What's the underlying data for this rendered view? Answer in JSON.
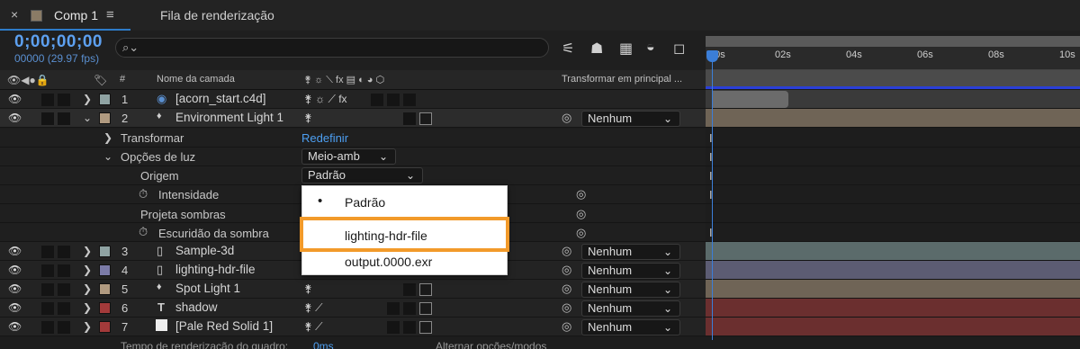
{
  "tabbar": {
    "close": "×",
    "comp_name": "Comp 1",
    "menu_icon": "≡",
    "render_tab": "Fila de renderização"
  },
  "header": {
    "timecode": "0;00;00;00",
    "fps": "00000 (29.97 fps)",
    "search_placeholder": "",
    "search_icon": "magnifier-icon",
    "icons": [
      "composition-flowchart-icon",
      "draft-3d-icon",
      "frame-blending-icon",
      "motion-blur-icon",
      "graph-editor-icon"
    ],
    "icon_glyphs": [
      "⚟",
      "☗",
      "▦",
      "◒",
      "◻"
    ]
  },
  "columns": {
    "av_icons": "👁◀●🔒",
    "label_icon": "🏷",
    "hash": "#",
    "layer_name": "Nome da camada",
    "switches": "⚵ ☼ ⟍ fx ▤ ◐ ◕ ⬡",
    "parent": "Transformar em principal ..."
  },
  "ruler": {
    "ticks": [
      "00s",
      "02s",
      "04s",
      "06s",
      "08s",
      "10s"
    ]
  },
  "layers": [
    {
      "num": "1",
      "name": "[acorn_start.c4d]",
      "label_color": "#8fa3a3",
      "icon": "c4d-icon",
      "glyph": "◉",
      "switches": "⚵ ☼ ⟋ fx",
      "parent": ""
    },
    {
      "num": "2",
      "name": "Environment Light 1",
      "label_color": "#b09a80",
      "icon": "light-icon",
      "glyph": "💡",
      "switches": "⚵",
      "parent": "Nenhum",
      "expanded": true
    },
    {
      "num": "3",
      "name": "Sample-3d",
      "label_color": "#8fa3a3",
      "icon": "file-icon",
      "glyph": "▯",
      "switches": "",
      "parent": "Nenhum"
    },
    {
      "num": "4",
      "name": "lighting-hdr-file",
      "label_color": "#7b7ba8",
      "icon": "image-file-icon",
      "glyph": "▯",
      "switches": "",
      "parent": "Nenhum"
    },
    {
      "num": "5",
      "name": "Spot Light 1",
      "label_color": "#b09a80",
      "icon": "light-icon",
      "glyph": "💡",
      "switches": "⚵",
      "parent": "Nenhum"
    },
    {
      "num": "6",
      "name": "shadow",
      "label_color": "#a33a3a",
      "icon": "text-icon",
      "glyph": "T",
      "switches": "⚵ ⟋",
      "parent": "Nenhum"
    },
    {
      "num": "7",
      "name": "[Pale Red Solid 1]",
      "label_color": "#a33a3a",
      "icon": "solid-icon",
      "glyph": "□",
      "switches": "⚵ ⟋",
      "parent": "Nenhum"
    }
  ],
  "props": {
    "transform": "Transformar",
    "reset": "Redefinir",
    "light_options": "Opções de luz",
    "light_type": "Meio-amb",
    "origin": "Origem",
    "origin_value": "Padrão",
    "intensity": "Intensidade",
    "casts_shadows": "Projeta sombras",
    "shadow_darkness": "Escuridão da sombra"
  },
  "menu": {
    "items": [
      {
        "label": "Padrão",
        "checked": true
      },
      {
        "label": "lighting-hdr-file",
        "highlighted": true
      },
      {
        "label": "output.0000.exr"
      }
    ],
    "bullet": "•"
  },
  "footer": {
    "render_time_label": "Tempo de renderização do quadro:",
    "render_time_value": "0ms",
    "toggle_label": "Alternar opções/modos"
  },
  "colors": {
    "accent_blue": "#2e7cc9",
    "timecode": "#5da0f0",
    "highlight": "#f29a2a",
    "track_layer1": "#6b6b6b",
    "track_light": "#6f6456",
    "track_footage": "#5b6b6b",
    "track_lavender": "#5c5c73",
    "track_red": "#6b2f2f"
  }
}
